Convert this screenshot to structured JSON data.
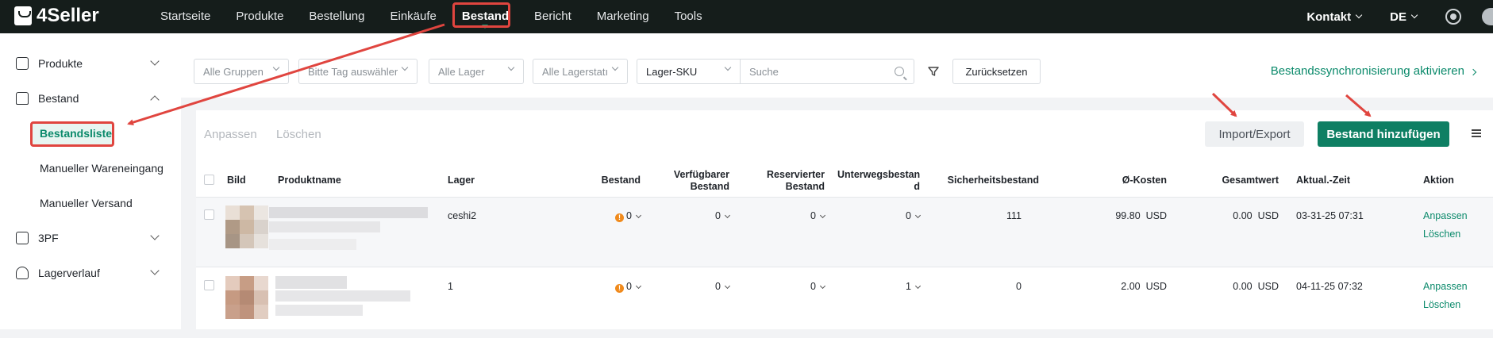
{
  "app": {
    "name": "4Seller"
  },
  "nav": [
    "Startseite",
    "Produkte",
    "Bestellung",
    "Einkäufe",
    "Bestand",
    "Bericht",
    "Marketing",
    "Tools"
  ],
  "top_right": {
    "contact": "Kontakt",
    "language": "DE"
  },
  "sidebar": {
    "items": [
      {
        "label": "Produkte",
        "icon": "product-icon"
      },
      {
        "label": "Bestand",
        "icon": "inventory-icon"
      },
      {
        "label": "3PF",
        "icon": "warehouse-icon"
      },
      {
        "label": "Lagerverlauf",
        "icon": "history-icon"
      }
    ],
    "sub_items": [
      "Bestandsliste",
      "Manueller Wareneingang",
      "Manueller Versand"
    ]
  },
  "filters": {
    "group": "Alle Gruppen",
    "tag": "Bitte Tag auswähler",
    "warehouse": "Alle Lager",
    "status": "Alle Lagerstatı",
    "sku_type": "Lager-SKU",
    "search_placeholder": "Suche",
    "reset": "Zurücksetzen",
    "sync_link": "Bestandssynchronisierung aktivieren"
  },
  "actions": {
    "adjust": "Anpassen",
    "delete": "Löschen",
    "import_export": "Import/Export",
    "add_stock": "Bestand hinzufügen"
  },
  "table": {
    "columns": {
      "image": "Bild",
      "product": "Produktname",
      "warehouse": "Lager",
      "stock": "Bestand",
      "available_1": "Verfügbarer",
      "available_2": "Bestand",
      "reserved_1": "Reservierter",
      "reserved_2": "Bestand",
      "transit_1": "Unterwegsbestan",
      "transit_2": "d",
      "safety": "Sicherheitsbestand",
      "avg_cost": "Ø-Kosten",
      "total": "Gesamtwert",
      "updated": "Aktual.-Zeit",
      "action": "Aktion"
    },
    "rows": [
      {
        "warehouse": "ceshi2",
        "stock": "0",
        "available": "0",
        "reserved": "0",
        "transit": "0",
        "safety": "111",
        "avg_cost": "99.80",
        "avg_cost_cur": "USD",
        "total": "0.00",
        "total_cur": "USD",
        "updated": "03-31-25 07:31",
        "action_edit": "Anpassen",
        "action_delete": "Löschen"
      },
      {
        "warehouse": "1",
        "stock": "0",
        "available": "0",
        "reserved": "0",
        "transit": "1",
        "safety": "0",
        "avg_cost": "2.00",
        "avg_cost_cur": "USD",
        "total": "0.00",
        "total_cur": "USD",
        "updated": "04-11-25 07:32",
        "action_edit": "Anpassen",
        "action_delete": "Löschen"
      }
    ]
  },
  "colors": {
    "topbar": "#151d1b",
    "accent": "#0e7f63",
    "annotation": "#e0453f",
    "warning": "#f08a1c"
  }
}
